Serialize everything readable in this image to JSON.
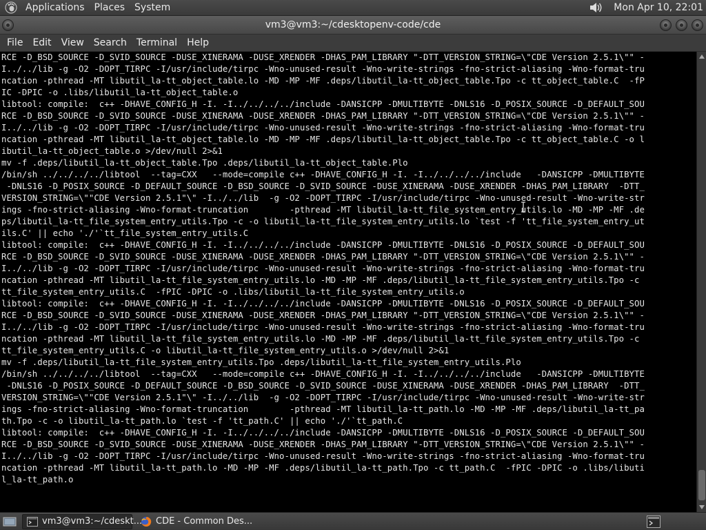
{
  "top_panel": {
    "logo_icon": "gnome-foot-icon",
    "menus": [
      "Applications",
      "Places",
      "System"
    ],
    "volume_icon": "speaker-icon",
    "clock": "Mon Apr 10, 22:01"
  },
  "window": {
    "title": "vm3@vm3:~/cdesktopenv-code/cde"
  },
  "menubar": {
    "items": [
      "File",
      "Edit",
      "View",
      "Search",
      "Terminal",
      "Help"
    ]
  },
  "terminal": {
    "lines": [
      "RCE -D_BSD_SOURCE -D_SVID_SOURCE -DUSE_XINERAMA -DUSE_XRENDER -DHAS_PAM_LIBRARY \"-DTT_VERSION_STRING=\\\"CDE Version 2.5.1\\\"\" -",
      "I../../lib -g -O2 -DOPT_TIRPC -I/usr/include/tirpc -Wno-unused-result -Wno-write-strings -fno-strict-aliasing -Wno-format-tru",
      "ncation -pthread -MT libutil_la-tt_object_table.lo -MD -MP -MF .deps/libutil_la-tt_object_table.Tpo -c tt_object_table.C  -fP",
      "IC -DPIC -o .libs/libutil_la-tt_object_table.o",
      "libtool: compile:  c++ -DHAVE_CONFIG_H -I. -I../../../../include -DANSICPP -DMULTIBYTE -DNLS16 -D_POSIX_SOURCE -D_DEFAULT_SOU",
      "RCE -D_BSD_SOURCE -D_SVID_SOURCE -DUSE_XINERAMA -DUSE_XRENDER -DHAS_PAM_LIBRARY \"-DTT_VERSION_STRING=\\\"CDE Version 2.5.1\\\"\" -",
      "I../../lib -g -O2 -DOPT_TIRPC -I/usr/include/tirpc -Wno-unused-result -Wno-write-strings -fno-strict-aliasing -Wno-format-tru",
      "ncation -pthread -MT libutil_la-tt_object_table.lo -MD -MP -MF .deps/libutil_la-tt_object_table.Tpo -c tt_object_table.C -o l",
      "ibutil_la-tt_object_table.o >/dev/null 2>&1",
      "mv -f .deps/libutil_la-tt_object_table.Tpo .deps/libutil_la-tt_object_table.Plo",
      "/bin/sh ../../../../libtool  --tag=CXX   --mode=compile c++ -DHAVE_CONFIG_H -I. -I../../../../include   -DANSICPP -DMULTIBYTE",
      " -DNLS16 -D_POSIX_SOURCE -D_DEFAULT_SOURCE -D_BSD_SOURCE -D_SVID_SOURCE -DUSE_XINERAMA -DUSE_XRENDER -DHAS_PAM_LIBRARY  -DTT_",
      "VERSION_STRING=\\\"\"CDE Version 2.5.1\"\\\" -I../../lib  -g -O2 -DOPT_TIRPC -I/usr/include/tirpc -Wno-unused-result -Wno-write-str",
      "ings -fno-strict-aliasing -Wno-format-truncation        -pthread -MT libutil_la-tt_file_system_entry_utils.lo -MD -MP -MF .de",
      "ps/libutil_la-tt_file_system_entry_utils.Tpo -c -o libutil_la-tt_file_system_entry_utils.lo `test -f 'tt_file_system_entry_ut",
      "ils.C' || echo './'`tt_file_system_entry_utils.C",
      "libtool: compile:  c++ -DHAVE_CONFIG_H -I. -I../../../../include -DANSICPP -DMULTIBYTE -DNLS16 -D_POSIX_SOURCE -D_DEFAULT_SOU",
      "RCE -D_BSD_SOURCE -D_SVID_SOURCE -DUSE_XINERAMA -DUSE_XRENDER -DHAS_PAM_LIBRARY \"-DTT_VERSION_STRING=\\\"CDE Version 2.5.1\\\"\" -",
      "I../../lib -g -O2 -DOPT_TIRPC -I/usr/include/tirpc -Wno-unused-result -Wno-write-strings -fno-strict-aliasing -Wno-format-tru",
      "ncation -pthread -MT libutil_la-tt_file_system_entry_utils.lo -MD -MP -MF .deps/libutil_la-tt_file_system_entry_utils.Tpo -c",
      "tt_file_system_entry_utils.C  -fPIC -DPIC -o .libs/libutil_la-tt_file_system_entry_utils.o",
      "libtool: compile:  c++ -DHAVE_CONFIG_H -I. -I../../../../include -DANSICPP -DMULTIBYTE -DNLS16 -D_POSIX_SOURCE -D_DEFAULT_SOU",
      "RCE -D_BSD_SOURCE -D_SVID_SOURCE -DUSE_XINERAMA -DUSE_XRENDER -DHAS_PAM_LIBRARY \"-DTT_VERSION_STRING=\\\"CDE Version 2.5.1\\\"\" -",
      "I../../lib -g -O2 -DOPT_TIRPC -I/usr/include/tirpc -Wno-unused-result -Wno-write-strings -fno-strict-aliasing -Wno-format-tru",
      "ncation -pthread -MT libutil_la-tt_file_system_entry_utils.lo -MD -MP -MF .deps/libutil_la-tt_file_system_entry_utils.Tpo -c",
      "tt_file_system_entry_utils.C -o libutil_la-tt_file_system_entry_utils.o >/dev/null 2>&1",
      "mv -f .deps/libutil_la-tt_file_system_entry_utils.Tpo .deps/libutil_la-tt_file_system_entry_utils.Plo",
      "/bin/sh ../../../../libtool  --tag=CXX   --mode=compile c++ -DHAVE_CONFIG_H -I. -I../../../../include   -DANSICPP -DMULTIBYTE",
      " -DNLS16 -D_POSIX_SOURCE -D_DEFAULT_SOURCE -D_BSD_SOURCE -D_SVID_SOURCE -DUSE_XINERAMA -DUSE_XRENDER -DHAS_PAM_LIBRARY  -DTT_",
      "VERSION_STRING=\\\"\"CDE Version 2.5.1\"\\\" -I../../lib  -g -O2 -DOPT_TIRPC -I/usr/include/tirpc -Wno-unused-result -Wno-write-str",
      "ings -fno-strict-aliasing -Wno-format-truncation        -pthread -MT libutil_la-tt_path.lo -MD -MP -MF .deps/libutil_la-tt_pa",
      "th.Tpo -c -o libutil_la-tt_path.lo `test -f 'tt_path.C' || echo './'`tt_path.C",
      "libtool: compile:  c++ -DHAVE_CONFIG_H -I. -I../../../../include -DANSICPP -DMULTIBYTE -DNLS16 -D_POSIX_SOURCE -D_DEFAULT_SOU",
      "RCE -D_BSD_SOURCE -D_SVID_SOURCE -DUSE_XINERAMA -DUSE_XRENDER -DHAS_PAM_LIBRARY \"-DTT_VERSION_STRING=\\\"CDE Version 2.5.1\\\"\" -",
      "I../../lib -g -O2 -DOPT_TIRPC -I/usr/include/tirpc -Wno-unused-result -Wno-write-strings -fno-strict-aliasing -Wno-format-tru",
      "ncation -pthread -MT libutil_la-tt_path.lo -MD -MP -MF .deps/libutil_la-tt_path.Tpo -c tt_path.C  -fPIC -DPIC -o .libs/libuti",
      "l_la-tt_path.o"
    ]
  },
  "taskbar": {
    "show_desktop_icon": "show-desktop-icon",
    "tasks": [
      {
        "label": "vm3@vm3:~/cdeskt...",
        "icon": "terminal-icon",
        "active": true
      },
      {
        "label": "CDE - Common Des...",
        "icon": "firefox-icon",
        "active": false
      }
    ],
    "tray_icon": "terminal-tray-icon"
  },
  "colors": {
    "terminal_bg": "#000000",
    "terminal_fg": "#e6e6e6",
    "panel_bg": "#3f3f3f"
  }
}
